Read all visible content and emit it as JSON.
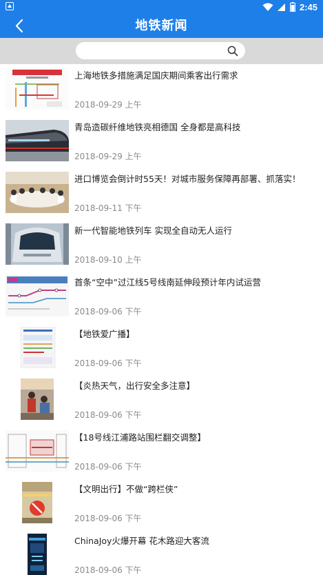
{
  "status_bar": {
    "time": "2:45",
    "icons": [
      "notification-icon",
      "wifi-icon",
      "signal-icon",
      "battery-icon"
    ]
  },
  "header": {
    "title": "地铁新闻",
    "back_icon": "chevron-left-icon"
  },
  "search": {
    "placeholder": "",
    "value": "",
    "icon": "search-icon"
  },
  "colors": {
    "primary": "#1f7fe8",
    "search_bg": "#d9d9d9",
    "date": "#8a8a8a"
  },
  "news": [
    {
      "title": "上海地铁多措施满足国庆期间乘客出行需求",
      "date": "2018-09-29 上午"
    },
    {
      "title": "青岛造碳纤维地铁亮相德国 全身都是高科技",
      "date": "2018-09-29 上午"
    },
    {
      "title": "进口博览会倒计时55天！对城市服务保障再部署、抓落实！",
      "date": "2018-09-11 下午"
    },
    {
      "title": "新一代智能地铁列车  实现全自动无人运行",
      "date": "2018-09-10 上午"
    },
    {
      "title": "首条“空中”过江线5号线南延伸段预计年内试运营",
      "date": "2018-09-06 下午"
    },
    {
      "title": "【地铁爱广播】",
      "date": "2018-09-06 下午"
    },
    {
      "title": "【炎热天气，出行安全多注意】",
      "date": "2018-09-06 下午"
    },
    {
      "title": "【18号线江浦路站围栏翻交调整】",
      "date": "2018-09-06 下午"
    },
    {
      "title": "【文明出行】不做“跨栏侠”",
      "date": "2018-09-06 下午"
    },
    {
      "title": "ChinaJoy火爆开幕 花木路迎大客流",
      "date": "2018-09-06 下午"
    }
  ]
}
